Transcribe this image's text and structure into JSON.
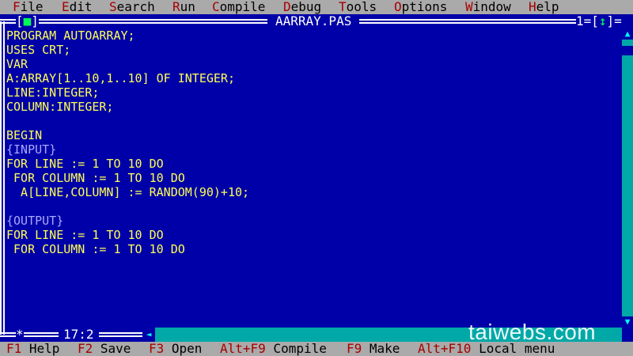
{
  "menu": {
    "items": [
      {
        "hot": "F",
        "rest": "ile"
      },
      {
        "hot": "E",
        "rest": "dit"
      },
      {
        "hot": "S",
        "rest": "earch"
      },
      {
        "hot": "R",
        "rest": "un"
      },
      {
        "hot": "C",
        "rest": "ompile"
      },
      {
        "hot": "D",
        "rest": "ebug"
      },
      {
        "hot": "T",
        "rest": "ools"
      },
      {
        "hot": "O",
        "rest": "ptions"
      },
      {
        "hot": "W",
        "rest": "indow"
      },
      {
        "hot": "H",
        "rest": "elp"
      }
    ]
  },
  "window": {
    "close_box_left": "[",
    "close_box_mark": "■",
    "close_box_right": "]",
    "title": "AARRAY.PAS",
    "number": "1=[",
    "zoom_mark": "↕",
    "number_close": "]="
  },
  "editor": {
    "lines": [
      {
        "text": "PROGRAM AUTOARRAY;",
        "type": "code"
      },
      {
        "text": "USES CRT;",
        "type": "code"
      },
      {
        "text": "VAR",
        "type": "code"
      },
      {
        "text": "A:ARRAY[1..10,1..10] OF INTEGER;",
        "type": "code"
      },
      {
        "text": "LINE:INTEGER;",
        "type": "code"
      },
      {
        "text": "COLUMN:INTEGER;",
        "type": "code"
      },
      {
        "text": "",
        "type": "code"
      },
      {
        "text": "BEGIN",
        "type": "code"
      },
      {
        "text": "{INPUT}",
        "type": "comment"
      },
      {
        "text": "FOR LINE := 1 TO 10 DO",
        "type": "code"
      },
      {
        "text": " FOR COLUMN := 1 TO 10 DO",
        "type": "code"
      },
      {
        "text": "  A[LINE,COLUMN] := RANDOM(90)+10;",
        "type": "code"
      },
      {
        "text": "",
        "type": "code"
      },
      {
        "text": "{OUTPUT}",
        "type": "comment"
      },
      {
        "text": "FOR LINE := 1 TO 10 DO",
        "type": "code"
      },
      {
        "text": " FOR COLUMN := 1 TO 10 DO",
        "type": "code"
      }
    ]
  },
  "cursor_position": "17:2",
  "corner_mark": "*",
  "watermark": "taiwebs.com",
  "statusbar": {
    "items": [
      {
        "key": "F1",
        "label": " Help"
      },
      {
        "key": "F2",
        "label": " Save"
      },
      {
        "key": "F3",
        "label": " Open"
      },
      {
        "key": "Alt+F9",
        "label": " Compile"
      },
      {
        "key": "F9",
        "label": " Make"
      },
      {
        "key": "Alt+F10",
        "label": " Local menu"
      }
    ]
  },
  "icons": {
    "scroll_up": "up-arrow-icon",
    "scroll_down": "down-arrow-icon",
    "scroll_left": "left-arrow-icon"
  },
  "colors": {
    "background": "#0000a8",
    "code_text": "#ffff55",
    "comment_text": "#a8a8ff",
    "menu_bg": "#aaaaaa",
    "hotkey": "#a80000",
    "scrollbar": "#00a8a8"
  }
}
